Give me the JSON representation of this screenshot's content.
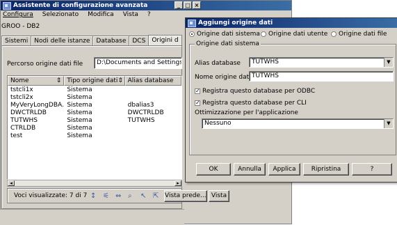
{
  "main_window": {
    "title": "Assistente di configurazione avanzata",
    "menu": [
      "Configura",
      "Selezionato",
      "Modifica",
      "Vista",
      "?"
    ],
    "group_label": "GROO - DB2",
    "tabs": [
      "Sistemi",
      "Nodi delle istanze",
      "Database",
      "DCS",
      "Origini d"
    ],
    "path_label": "Percorso origine dati file",
    "path_value": "D:\\Documents and Settings\\",
    "columns": [
      "Nome",
      "Tipo origine dati",
      "Alias database"
    ],
    "rows": [
      {
        "name": "tstcli1x",
        "type": "Sistema",
        "alias": ""
      },
      {
        "name": "tstcli2x",
        "type": "Sistema",
        "alias": ""
      },
      {
        "name": "MyVeryLongDBA...",
        "type": "Sistema",
        "alias": "dbalias3"
      },
      {
        "name": "DWCTRLDB",
        "type": "Sistema",
        "alias": "DWCTRLDB"
      },
      {
        "name": "TUTWHS",
        "type": "Sistema",
        "alias": "TUTWHS"
      },
      {
        "name": "CTRLDB",
        "type": "Sistema",
        "alias": ""
      },
      {
        "name": "test",
        "type": "Sistema",
        "alias": ""
      }
    ],
    "status": "Voci visualizzate: 7 di 7",
    "view_button": "Vista prede...",
    "view_button2": "Vista"
  },
  "dialog": {
    "title": "Aggiungi origine dati",
    "radios": [
      {
        "label": "Origine dati sistema",
        "selected": true
      },
      {
        "label": "Origine dati utente",
        "selected": false
      },
      {
        "label": "Origine dati file",
        "selected": false
      }
    ],
    "group_title": "Origine dati sistema",
    "alias_label": "Alias database",
    "alias_value": "TUTWHS",
    "name_label": "Nome origine dati",
    "name_value": "TUTWHS",
    "check_odbc": "Registra questo database per ODBC",
    "check_cli": "Registra questo database per CLI",
    "optimize_label": "Ottimizzazione per l'applicazione",
    "optimize_value": "Nessuno",
    "buttons": {
      "ok": "OK",
      "cancel": "Annulla",
      "apply": "Applica",
      "reset": "Ripristina",
      "help": "?"
    }
  },
  "icons": {
    "app": "app-window-icon",
    "check": "checkmark-icon"
  }
}
